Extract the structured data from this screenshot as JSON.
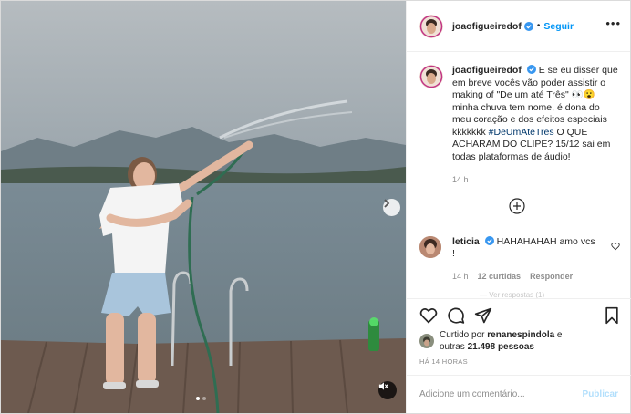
{
  "post": {
    "author": "joaofigueiredof",
    "separator": "•",
    "follow_label": "Seguir",
    "more_label": "•••",
    "caption_author": "joaofigueiredof",
    "caption_before": "E se eu disser que em breve vocês vão poder assistir o making of \"De um até Três\" 👀😮 minha chuva tem nome, é dona do meu coração e dos efeitos especiais kkkkkkk ",
    "caption_hashtag": "#DeUmAteTres",
    "caption_after": " O QUE ACHARAM DO CLIPE? 15/12 sai em todas plataformas de áudio!",
    "caption_time": "14 h",
    "comment": {
      "author": "leticia",
      "text": "HAHAHAHAH amo vcs !",
      "time": "14 h",
      "replies_label": "12 curtidas",
      "reply_label": "Responder"
    },
    "hidden_more": "— Ver respostas (1)",
    "liked_by_prefix": "Curtido por ",
    "liked_by_user": "renanespindola",
    "liked_by_mid": " e",
    "liked_by_others_prefix": "outras ",
    "liked_by_count": "21.498 pessoas",
    "time_ago": "HÁ 14 HORAS",
    "add_comment_placeholder": "Adicione um comentário...",
    "publish_label": "Publicar"
  },
  "media": {
    "carousel_position": 1,
    "carousel_total": 2
  },
  "icons": {
    "heart": "heart-icon",
    "comment": "comment-icon",
    "share": "share-icon",
    "save": "bookmark-icon",
    "mute": "muted-speaker-icon",
    "next": "chevron-right-icon",
    "verified": "verified-badge-icon",
    "load_more": "plus-circle-icon"
  },
  "colors": {
    "accent": "#0095f6",
    "publish_disabled": "#b2dffc",
    "hashtag": "#00376b"
  }
}
